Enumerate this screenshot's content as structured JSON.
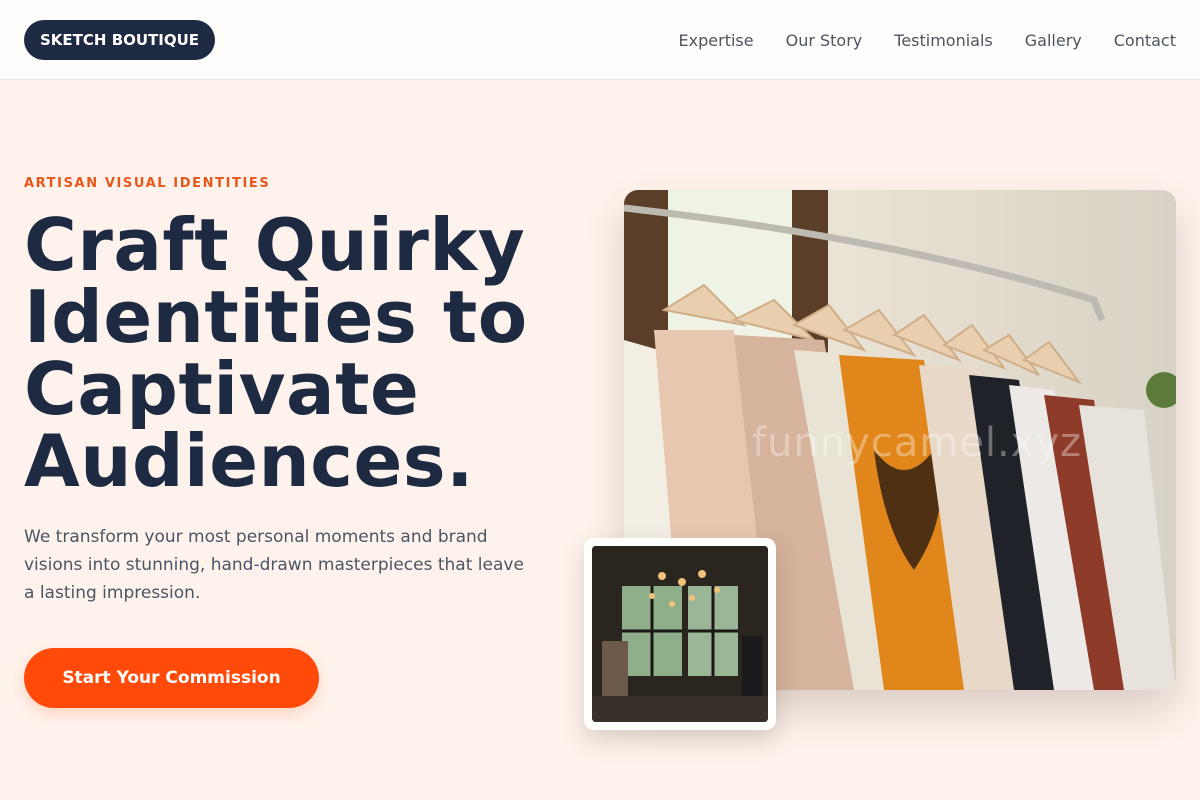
{
  "brand": {
    "logo_text": "SKETCH BOUTIQUE"
  },
  "nav": {
    "links": [
      "Expertise",
      "Our Story",
      "Testimonials",
      "Gallery",
      "Contact"
    ]
  },
  "hero": {
    "eyebrow": "ARTISAN VISUAL IDENTITIES",
    "headline_lines": [
      "Craft Quirky",
      "Identities to",
      "Captivate",
      "Audiences."
    ],
    "subtext": "We transform your most personal moments and brand visions into stunning, hand-drawn masterpieces that leave a lasting impression.",
    "cta_label": "Start Your Commission"
  },
  "images": {
    "main_watermark": "funnycamel.xyz"
  },
  "colors": {
    "accent": "#ff4a0a",
    "eyebrow": "#e8561a",
    "navy": "#1e2a42",
    "background": "#fef3ec"
  }
}
